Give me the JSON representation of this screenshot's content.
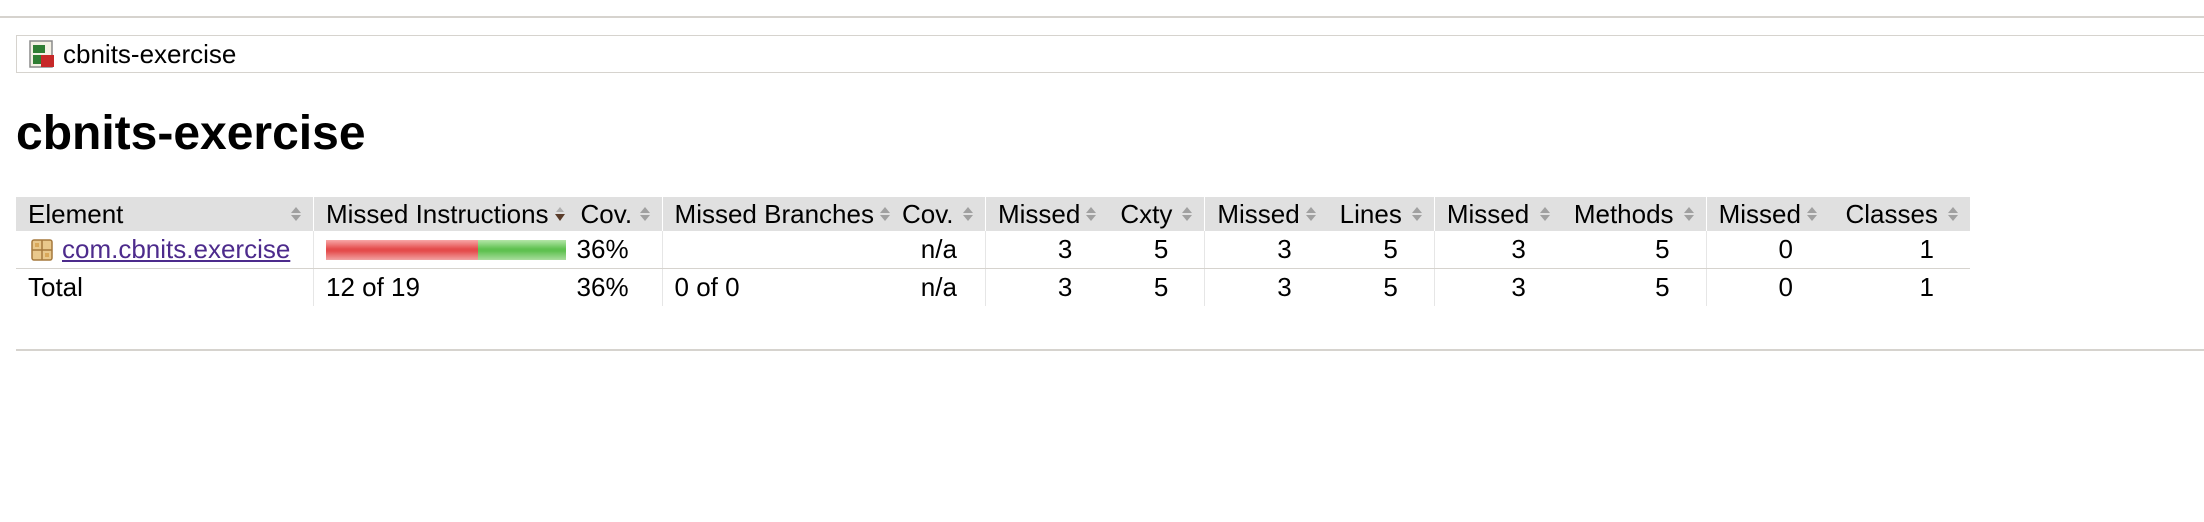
{
  "breadcrumb": {
    "session_label": "cbnits-exercise",
    "icon": "session-icon"
  },
  "page_title": "cbnits-exercise",
  "table": {
    "headers": [
      "Element",
      "Missed Instructions",
      "Cov.",
      "Missed Branches",
      "Cov.",
      "Missed",
      "Cxty",
      "Missed",
      "Lines",
      "Missed",
      "Methods",
      "Missed",
      "Classes"
    ],
    "sorted_column": "Missed Instructions",
    "rows": [
      {
        "element": "com.cbnits.exercise",
        "icon": "package-icon",
        "instructions_missed_fraction": 0.632,
        "instructions_cov": "36%",
        "branches": "",
        "branches_cov": "n/a",
        "cxty_missed": "3",
        "cxty": "5",
        "lines_missed": "3",
        "lines": "5",
        "methods_missed": "3",
        "methods": "5",
        "classes_missed": "0",
        "classes": "1"
      }
    ],
    "total": {
      "label": "Total",
      "instructions": "12 of 19",
      "instructions_cov": "36%",
      "branches": "0 of 0",
      "branches_cov": "n/a",
      "cxty_missed": "3",
      "cxty": "5",
      "lines_missed": "3",
      "lines": "5",
      "methods_missed": "3",
      "methods": "5",
      "classes_missed": "0",
      "classes": "1"
    }
  },
  "colors": {
    "header_bg": "#e0e0e0",
    "missed_bar": "#e44c4c",
    "covered_bar": "#5fc150",
    "link": "#4d2b8c",
    "rule": "#d6d3ce"
  }
}
